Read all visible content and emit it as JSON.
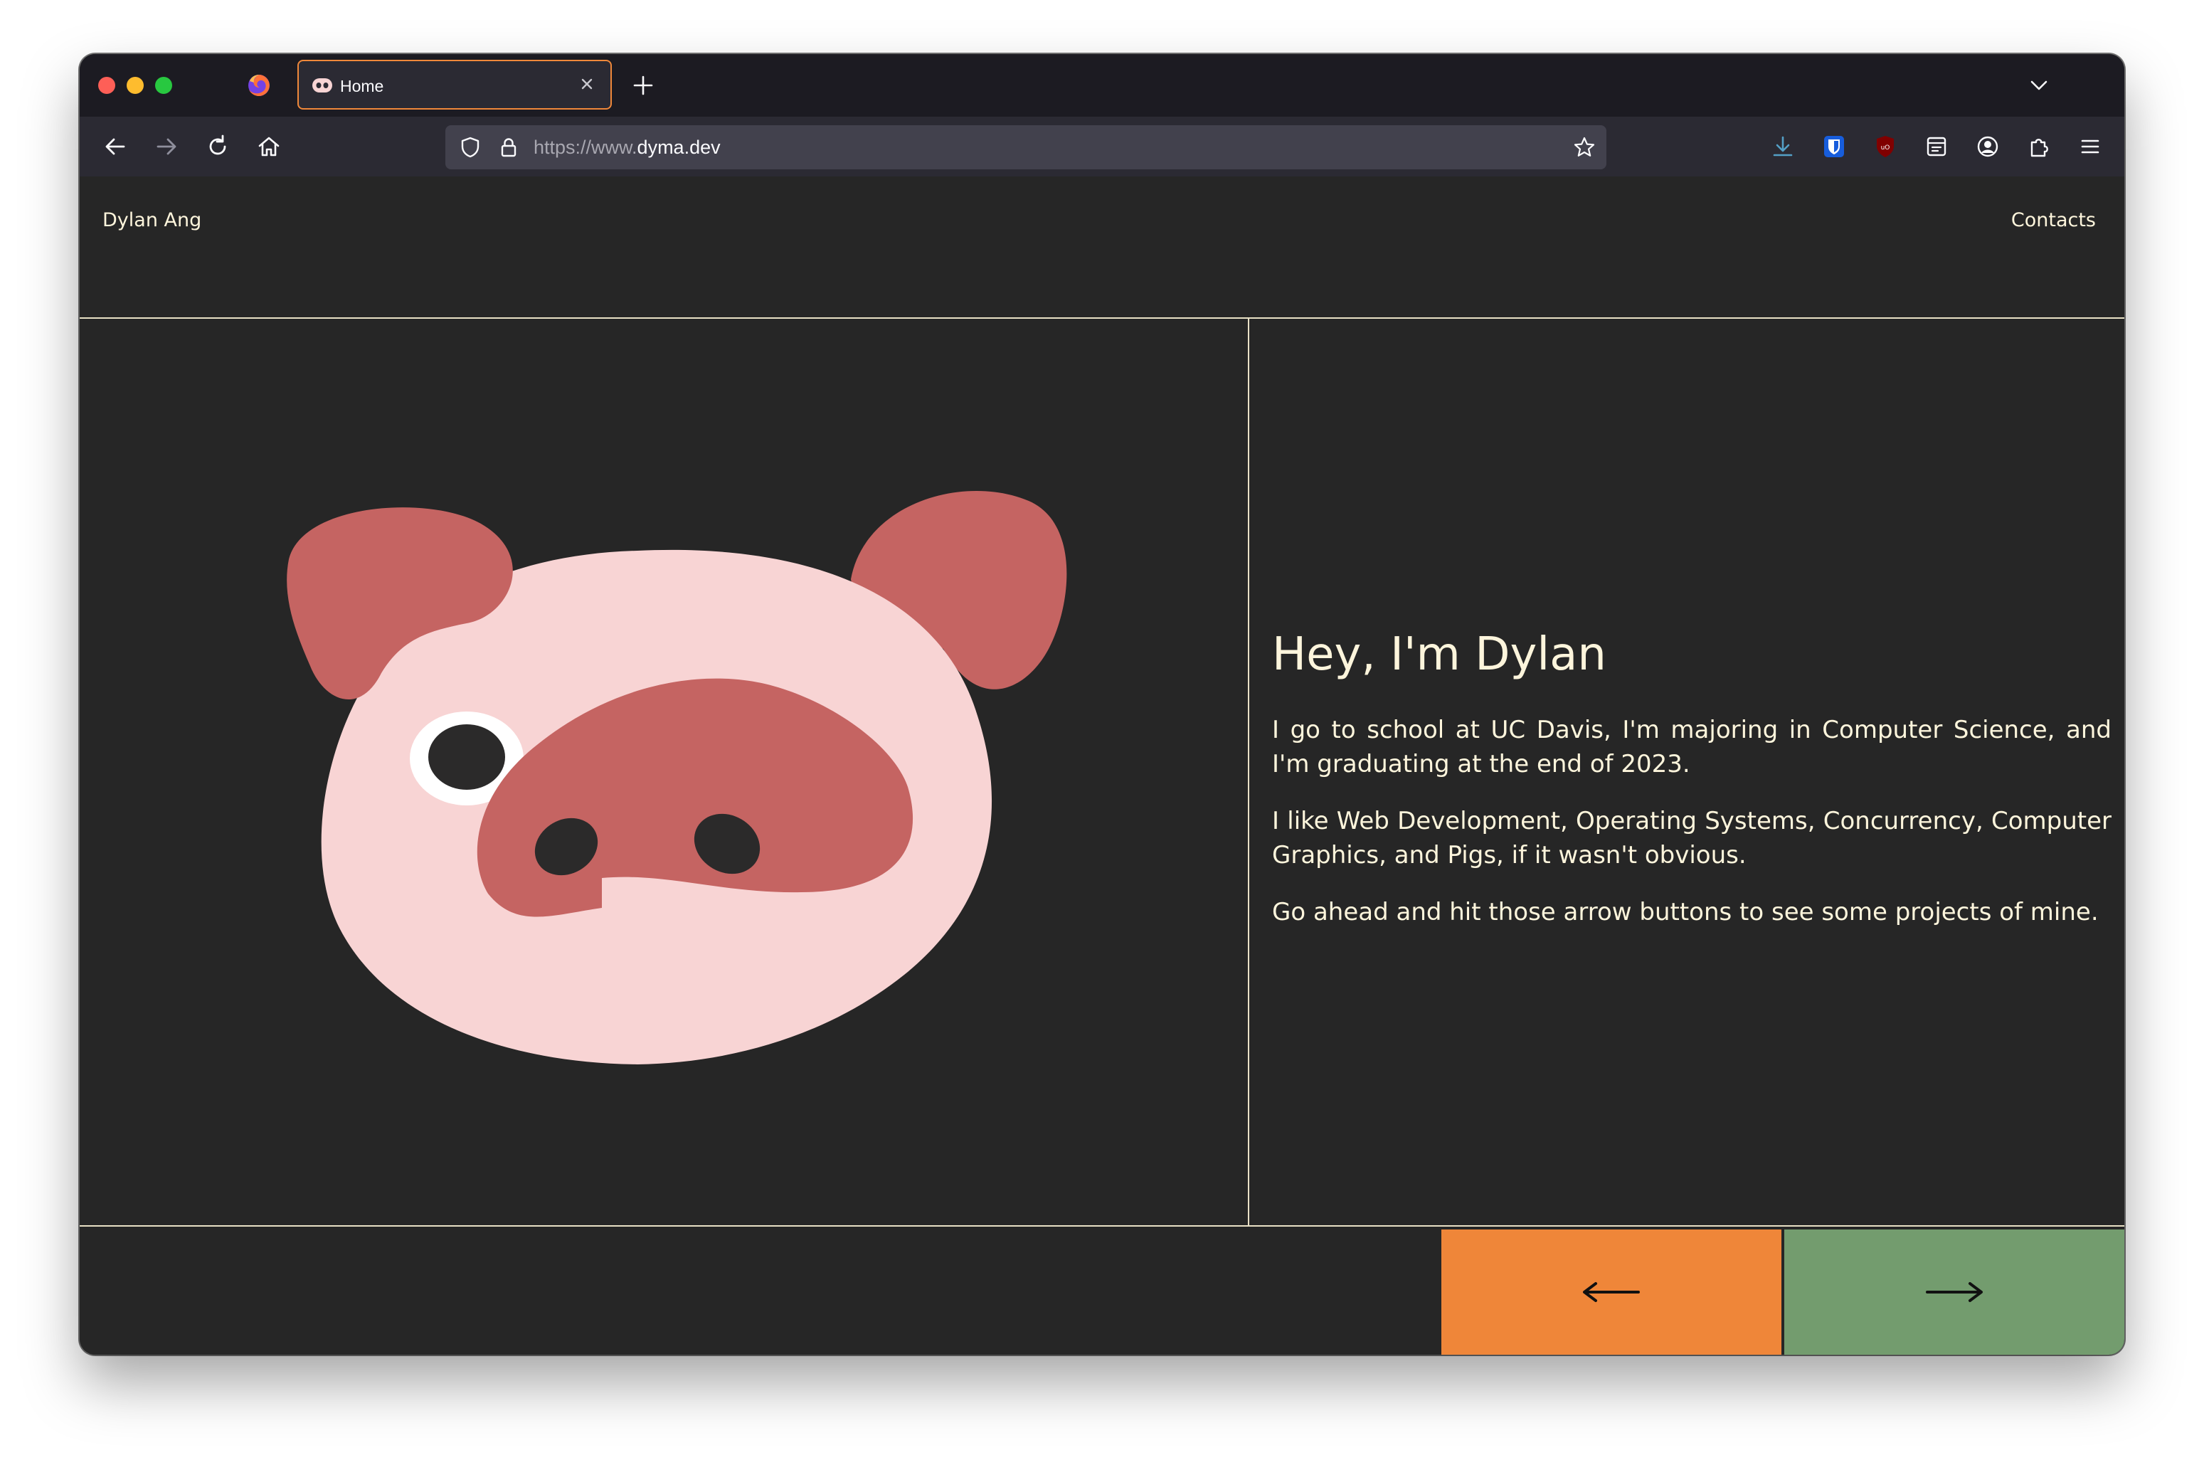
{
  "browser": {
    "tab": {
      "title": "Home"
    },
    "url": {
      "prefix": "https://www.",
      "domain": "dyma.dev"
    }
  },
  "site": {
    "name": "Dylan Ang",
    "nav_contacts": "Contacts"
  },
  "hero": {
    "heading": "Hey, I'm Dylan",
    "paragraphs": [
      "I go to school at UC Davis, I'm majoring in Computer Science, and I'm graduating at the end of 2023.",
      "I like Web Development, Operating Systems, Concurrency, Computer Graphics, and Pigs, if it wasn't obvious.",
      "Go ahead and hit those arrow buttons to see some projects of mine."
    ]
  },
  "controls": {
    "prev_icon": "left-arrow-icon",
    "next_icon": "right-arrow-icon"
  },
  "colors": {
    "background": "#262626",
    "text": "#fdf5dc",
    "prev_button": "#ef8639",
    "next_button": "#739c6e",
    "pig_face": "#f8d4d4",
    "pig_ears_snout": "#c56462"
  }
}
